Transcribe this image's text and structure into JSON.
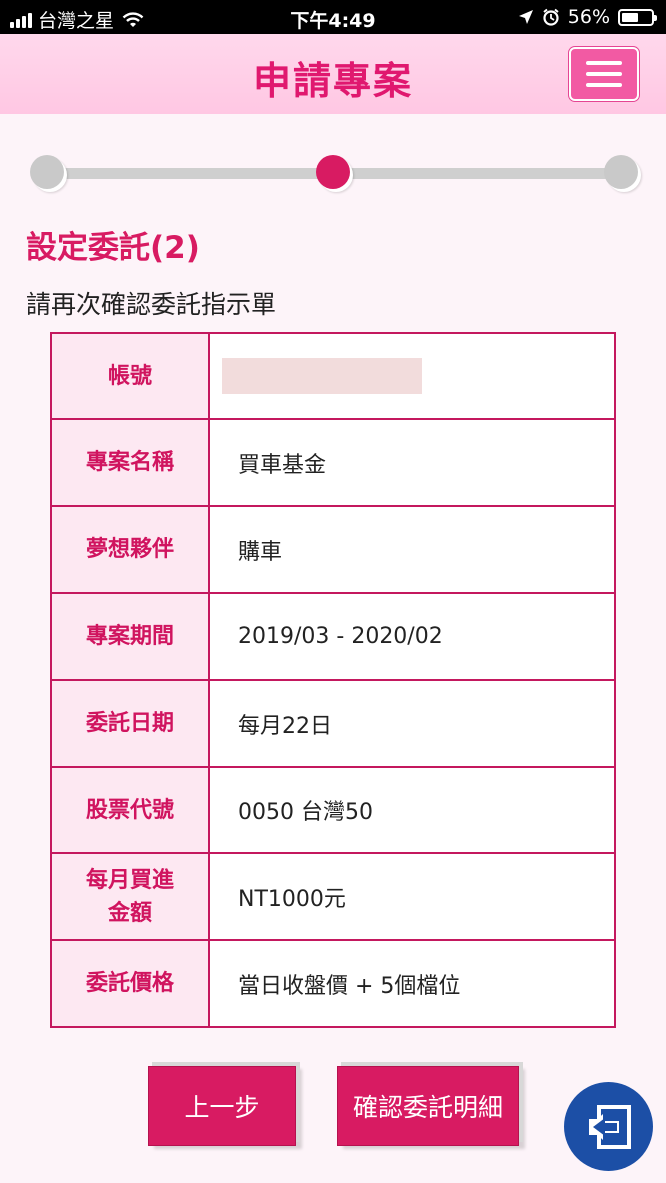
{
  "status_bar": {
    "carrier": "台灣之星",
    "time": "下午4:49",
    "battery": "56%",
    "battery_level": 0.56
  },
  "header": {
    "title": "申請專案",
    "menu_icon": "hamburger-menu-icon"
  },
  "progress": {
    "steps": 3,
    "current_step": 2
  },
  "section": {
    "title": "設定委託(2)",
    "subtitle": "請再次確認委託指示單"
  },
  "details": [
    {
      "label": "帳號",
      "value": ""
    },
    {
      "label": "專案名稱",
      "value": "買車基金"
    },
    {
      "label": "夢想夥伴",
      "value": "購車"
    },
    {
      "label": "專案期間",
      "value": "2019/03 - 2020/02"
    },
    {
      "label": "委託日期",
      "value": "每月22日"
    },
    {
      "label": "股票代號",
      "value": "0050 台灣50"
    },
    {
      "label": "每月買進金額",
      "value": "NT1000元"
    },
    {
      "label": "委託價格",
      "value": "當日收盤價 + 5個檔位"
    }
  ],
  "buttons": {
    "prev": "上一步",
    "confirm": "確認委託明細"
  },
  "colors": {
    "accent": "#d81b62",
    "header_bg": "#ffd0e8",
    "exit_fab": "#1c4fa6"
  },
  "exit_icon": "logout-icon"
}
